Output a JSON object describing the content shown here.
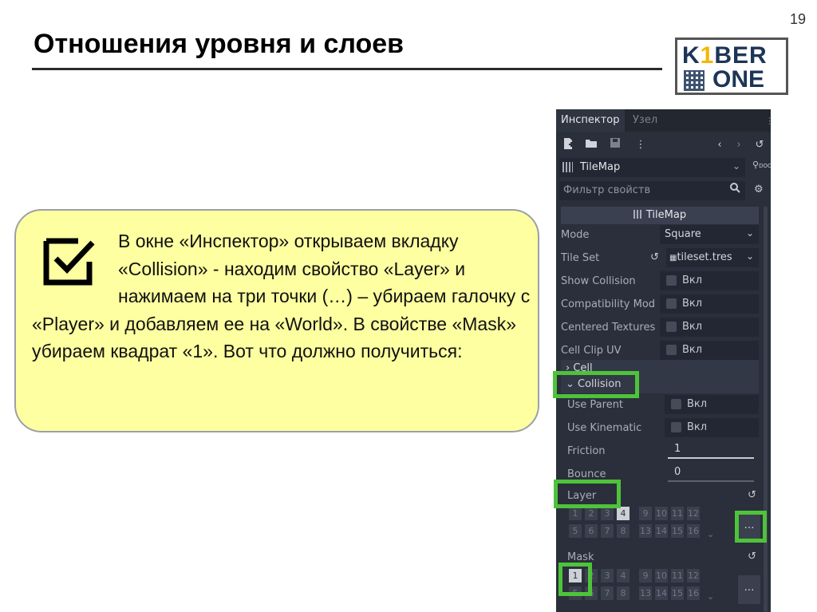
{
  "slide": {
    "page_number": "19",
    "title": "Отношения уровня и слоев",
    "logo_line1_a": "K",
    "logo_line1_b": "1",
    "logo_line1_c": "BER",
    "logo_line2": "ONE",
    "instruction": "В окне «Инспектор» открываем вкладку «Collision» - находим свойство «Layer» и нажимаем на три точки (…) – убираем галочку с «Player» и добавляем ее на «World». В свойстве «Mask» убираем квадрат «1». Вот что должно получиться:"
  },
  "inspector": {
    "tabs": [
      "Инспектор",
      "Узел"
    ],
    "toolbar_icons": [
      "new-resource-icon",
      "open-folder-icon",
      "save-icon",
      "more-vertical-icon",
      "back-icon",
      "forward-icon",
      "history-icon"
    ],
    "node_selector": "TileMap",
    "doc_label": "DOC",
    "filter_placeholder": "Фильтр свойств",
    "section_title": "TileMap",
    "mode": {
      "label": "Mode",
      "value": "Square"
    },
    "tile_set": {
      "label": "Tile Set",
      "value": "tileset.tres"
    },
    "checkbox_label": "Вкл",
    "props": [
      "Show Collision",
      "Compatibility Mod",
      "Centered Textures",
      "Cell Clip UV"
    ],
    "cell_group": "Cell",
    "collision_group": "Collision",
    "collision_props": [
      "Use Parent",
      "Use Kinematic"
    ],
    "friction": {
      "label": "Friction",
      "value": "1",
      "fraction": 1.0
    },
    "bounce": {
      "label": "Bounce",
      "value": "0",
      "fraction": 0.0
    },
    "layer": {
      "label": "Layer",
      "bits": [
        "1",
        "2",
        "3",
        "4",
        "9",
        "10",
        "11",
        "12",
        "5",
        "6",
        "7",
        "8",
        "13",
        "14",
        "15",
        "16"
      ],
      "enabled": [
        "4"
      ]
    },
    "mask": {
      "label": "Mask",
      "bits": [
        "1",
        "2",
        "3",
        "4",
        "9",
        "10",
        "11",
        "12",
        "5",
        "6",
        "7",
        "8",
        "13",
        "14",
        "15",
        "16"
      ],
      "enabled": [
        "1"
      ]
    },
    "more_button": "…",
    "highlight_color": "#4ec33a"
  }
}
